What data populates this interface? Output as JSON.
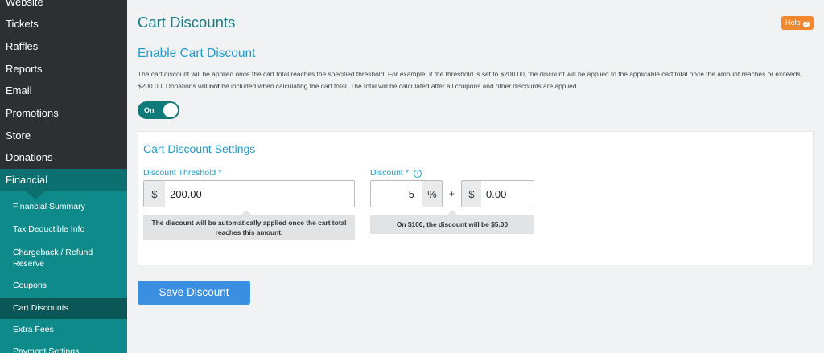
{
  "sidebar": {
    "main_items": [
      {
        "label": "Website"
      },
      {
        "label": "Tickets"
      },
      {
        "label": "Raffles"
      },
      {
        "label": "Reports"
      },
      {
        "label": "Email"
      },
      {
        "label": "Promotions"
      },
      {
        "label": "Store"
      },
      {
        "label": "Donations"
      },
      {
        "label": "Financial"
      }
    ],
    "sub_items": [
      {
        "label": "Financial Summary"
      },
      {
        "label": "Tax Deductible Info"
      },
      {
        "label": "Chargeback / Refund Reserve"
      },
      {
        "label": "Coupons"
      },
      {
        "label": "Cart Discounts"
      },
      {
        "label": "Extra Fees"
      },
      {
        "label": "Payment Settings"
      }
    ]
  },
  "header": {
    "title": "Cart Discounts",
    "help_label": "Help",
    "help_icon": "question-circle-icon"
  },
  "enable_section": {
    "title": "Enable Cart Discount",
    "desc_part1": "The cart discount will be applied once the cart total reaches the specified threshold. For example, if the threshold is set to $200.00, the discount will be applied to the applicable cart total once the amount reaches or exceeds $200.00. Donations will ",
    "desc_bold": "not",
    "desc_part2": " be included when calculating the cart total. The total will be calculated after all coupons and other discounts are applied.",
    "toggle_label": "On",
    "toggle_on": true
  },
  "settings": {
    "title": "Cart Discount Settings",
    "threshold": {
      "label": "Discount Threshold *",
      "prefix": "$",
      "value": "200.00",
      "hint": "The discount will be automatically applied once the cart total reaches this amount."
    },
    "discount": {
      "label": "Discount *",
      "info_icon": "info-icon",
      "percent_value": "5",
      "percent_suffix": "%",
      "plus": "+",
      "amount_prefix": "$",
      "amount_value": "0.00",
      "hint": "On $100, the discount will be $5.00"
    }
  },
  "actions": {
    "save_label": "Save Discount"
  }
}
